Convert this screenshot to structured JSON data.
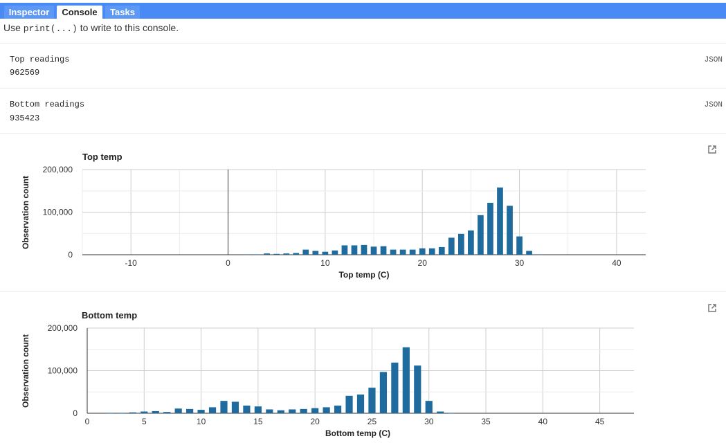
{
  "tabs": [
    {
      "label": "Inspector",
      "active": false
    },
    {
      "label": "Console",
      "active": true
    },
    {
      "label": "Tasks",
      "active": false
    }
  ],
  "hint": {
    "prefix": "Use ",
    "code": "print(...)",
    "suffix": " to write to this console."
  },
  "entries": [
    {
      "label": "Top readings",
      "value": "962569",
      "link": "JSON"
    },
    {
      "label": "Bottom readings",
      "value": "935423",
      "link": "JSON"
    }
  ],
  "colors": {
    "tabbar": "#4a8af4",
    "bar": "#1f6b9e",
    "grid": "#cccccc"
  },
  "icons": {
    "popout": "open-in-new-icon"
  },
  "chart_data": [
    {
      "type": "bar",
      "title": "Top temp",
      "xlabel": "Top temp (C)",
      "ylabel": "Observation count",
      "xlim": [
        -15,
        43
      ],
      "ylim": [
        0,
        200000
      ],
      "xticks": [
        -10,
        0,
        10,
        20,
        30,
        40
      ],
      "xtick_labels": [
        "-10",
        "0",
        "10",
        "20",
        "30",
        "40"
      ],
      "yticks": [
        0,
        100000,
        200000
      ],
      "ytick_labels": [
        "0",
        "100,000",
        "200,000"
      ],
      "grid": true,
      "bar_width": 1,
      "x": [
        2,
        3,
        4,
        5,
        6,
        7,
        8,
        9,
        10,
        11,
        12,
        13,
        14,
        15,
        16,
        17,
        18,
        19,
        20,
        21,
        22,
        23,
        24,
        25,
        26,
        27,
        28,
        29,
        30,
        31,
        32
      ],
      "values": [
        1000,
        1000,
        3000,
        2000,
        3000,
        4000,
        12000,
        9000,
        7000,
        10000,
        22000,
        22000,
        23000,
        19000,
        20000,
        12000,
        12000,
        12000,
        15000,
        15000,
        18000,
        40000,
        49000,
        57000,
        93000,
        122000,
        158000,
        115000,
        43000,
        9000,
        1000
      ]
    },
    {
      "type": "bar",
      "title": "Bottom temp",
      "xlabel": "Bottom temp (C)",
      "ylabel": "Observation count",
      "xlim": [
        0,
        48
      ],
      "ylim": [
        0,
        200000
      ],
      "xticks": [
        0,
        5,
        10,
        15,
        20,
        25,
        30,
        35,
        40,
        45
      ],
      "xtick_labels": [
        "0",
        "5",
        "10",
        "15",
        "20",
        "25",
        "30",
        "35",
        "40",
        "45"
      ],
      "yticks": [
        0,
        100000,
        200000
      ],
      "ytick_labels": [
        "0",
        "100,000",
        "200,000"
      ],
      "grid": true,
      "bar_width": 1,
      "x": [
        2,
        3,
        4,
        5,
        6,
        7,
        8,
        9,
        10,
        11,
        12,
        13,
        14,
        15,
        16,
        17,
        18,
        19,
        20,
        21,
        22,
        23,
        24,
        25,
        26,
        27,
        28,
        29,
        30,
        31,
        32
      ],
      "values": [
        1000,
        1000,
        2000,
        4000,
        5000,
        3000,
        11000,
        10000,
        8000,
        14000,
        29000,
        27000,
        18000,
        16000,
        9000,
        7000,
        9000,
        10000,
        12000,
        14000,
        18000,
        41000,
        44000,
        60000,
        97000,
        119000,
        155000,
        112000,
        29000,
        4000,
        1000
      ]
    }
  ]
}
